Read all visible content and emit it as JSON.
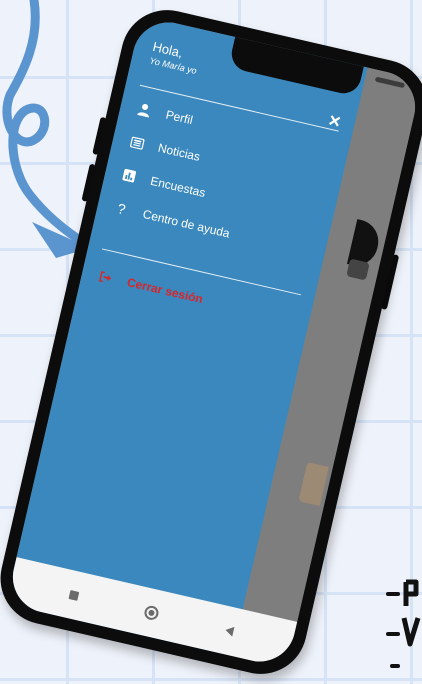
{
  "drawer": {
    "greeting": "Hola,",
    "user_name": "Yo María yo",
    "close_symbol": "×",
    "menu": [
      {
        "label": "Perfil",
        "icon": "person-icon",
        "glyph": "●"
      },
      {
        "label": "Noticias",
        "icon": "newspaper-icon",
        "glyph": "▤"
      },
      {
        "label": "Encuestas",
        "icon": "bar-chart-icon",
        "glyph": "▥"
      },
      {
        "label": "Centro de ayuda",
        "icon": "question-icon",
        "glyph": "?"
      }
    ],
    "logout": {
      "label": "Cerrar sesión",
      "icon": "sign-out-icon",
      "glyph": "[→"
    }
  },
  "colors": {
    "drawer_bg": "#3a88bd",
    "logout_red": "#d9252a",
    "arrow_blue": "#5b95d0"
  }
}
